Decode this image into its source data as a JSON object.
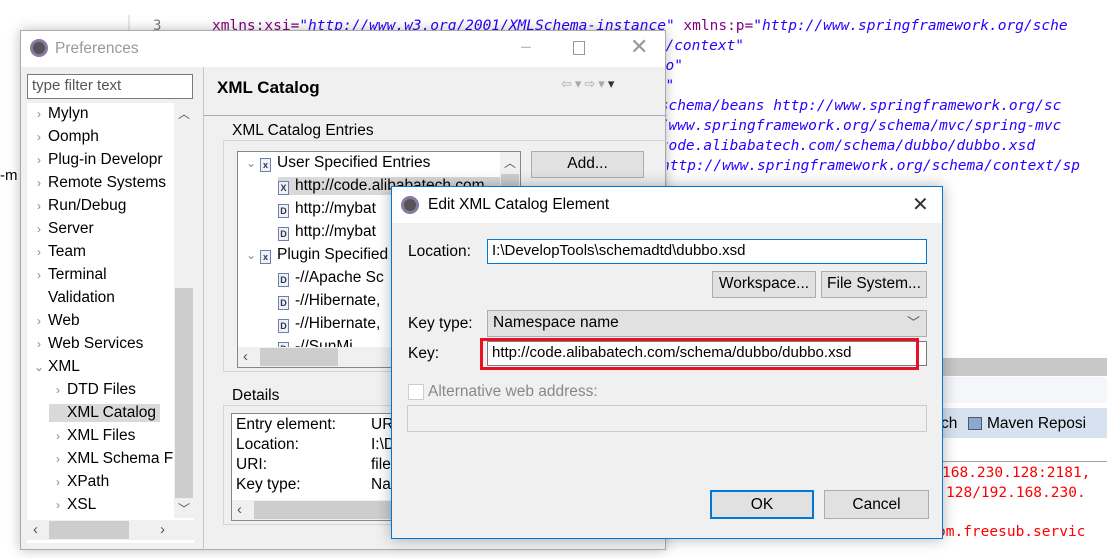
{
  "editor": {
    "line_number": "3",
    "left_fragment": "-m",
    "lines": [
      {
        "attr": "xmlns:xsi=",
        "val": "\"http://www.w3.org/2001/XMLSchema-instance\"",
        "attr2": " xmlns:p=",
        "val2": "\"http://www.springframework.org/sche"
      },
      {
        "val": "ma/context\""
      },
      {
        "val": "bbo\""
      },
      {
        "val": "vc\""
      },
      {
        "val": "/schema/beans http://www.springframework.org/sc"
      },
      {
        "val": "//www.springframework.org/schema/mvc/spring-mvc"
      },
      {
        "val": "/code.alibabatech.com/schema/dubbo/dubbo.xsd"
      },
      {
        "val": "http://www.springframework.org/schema/context/sp"
      }
    ],
    "console_tabs": [
      "ch",
      "Maven Reposi"
    ],
    "console_lines": [
      "168.230.128:2181,",
      "128/192.168.230.",
      "om.freesub.servic"
    ]
  },
  "preferences": {
    "title": "Preferences",
    "filter_placeholder": "type filter text",
    "tree": [
      {
        "label": "Mylyn",
        "level": 0,
        "exp": "collapsed"
      },
      {
        "label": "Oomph",
        "level": 0,
        "exp": "collapsed"
      },
      {
        "label": "Plug-in Developr",
        "level": 0,
        "exp": "collapsed"
      },
      {
        "label": "Remote Systems",
        "level": 0,
        "exp": "collapsed"
      },
      {
        "label": "Run/Debug",
        "level": 0,
        "exp": "collapsed"
      },
      {
        "label": "Server",
        "level": 0,
        "exp": "collapsed"
      },
      {
        "label": "Team",
        "level": 0,
        "exp": "collapsed"
      },
      {
        "label": "Terminal",
        "level": 0,
        "exp": "collapsed"
      },
      {
        "label": "Validation",
        "level": 0,
        "exp": "none"
      },
      {
        "label": "Web",
        "level": 0,
        "exp": "collapsed"
      },
      {
        "label": "Web Services",
        "level": 0,
        "exp": "collapsed"
      },
      {
        "label": "XML",
        "level": 0,
        "exp": "expanded"
      },
      {
        "label": "DTD Files",
        "level": 1,
        "exp": "collapsed"
      },
      {
        "label": "XML Catalog",
        "level": 1,
        "exp": "none",
        "selected": true
      },
      {
        "label": "XML Files",
        "level": 1,
        "exp": "collapsed"
      },
      {
        "label": "XML Schema F",
        "level": 1,
        "exp": "collapsed"
      },
      {
        "label": "XPath",
        "level": 1,
        "exp": "collapsed"
      },
      {
        "label": "XSL",
        "level": 1,
        "exp": "collapsed"
      }
    ],
    "page_title": "XML Catalog",
    "entries_group": "XML Catalog Entries",
    "entries": [
      {
        "label": "User Specified Entries",
        "level": 0,
        "icon": "catalog"
      },
      {
        "label": "http://code.alibabatech.com",
        "level": 1,
        "icon": "X",
        "selected": true
      },
      {
        "label": "http://mybat",
        "level": 1,
        "icon": "D"
      },
      {
        "label": "http://mybat",
        "level": 1,
        "icon": "D"
      },
      {
        "label": "Plugin Specified",
        "level": 0,
        "icon": "catalog"
      },
      {
        "label": "-//Apache Sc",
        "level": 1,
        "icon": "D"
      },
      {
        "label": "-//Hibernate,",
        "level": 1,
        "icon": "D"
      },
      {
        "label": "-//Hibernate,",
        "level": 1,
        "icon": "D"
      },
      {
        "label": "-//SunMi",
        "level": 1,
        "icon": "D"
      }
    ],
    "add_button": "Add...",
    "details_group": "Details",
    "details": [
      {
        "k": "Entry element:",
        "v": "UR"
      },
      {
        "k": "Location:",
        "v": "I:\\D"
      },
      {
        "k": "URI:",
        "v": "file"
      },
      {
        "k": "Key type:",
        "v": "Na"
      }
    ]
  },
  "edit_dialog": {
    "title": "Edit XML Catalog Element",
    "location_label": "Location:",
    "location_value": "I:\\DevelopTools\\schemadtd\\dubbo.xsd",
    "workspace_button": "Workspace...",
    "filesystem_button": "File System...",
    "key_type_label": "Key type:",
    "key_type_value": "Namespace name",
    "key_label": "Key:",
    "key_value": "http://code.alibabatech.com/schema/dubbo/dubbo.xsd",
    "alt_label": "Alternative web address:",
    "alt_checked": false,
    "alt_value": "",
    "ok_button": "OK",
    "cancel_button": "Cancel",
    "highlight_color": "#e81123",
    "accent": "#0078d7"
  }
}
